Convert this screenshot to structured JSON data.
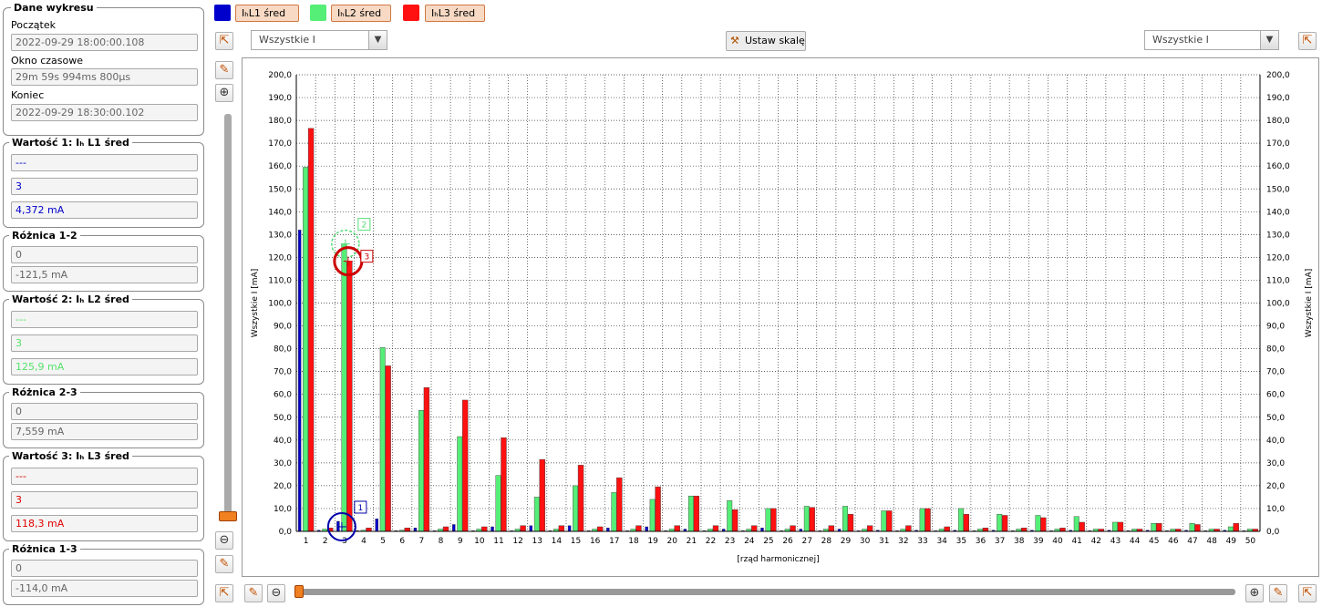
{
  "info": {
    "title": "Dane wykresu",
    "start_label": "Początek",
    "start_value": "2022-09-29 18:00:00.108",
    "window_label": "Okno czasowe",
    "window_value": "29m 59s 994ms 800µs",
    "end_label": "Koniec",
    "end_value": "2022-09-29 18:30:00.102"
  },
  "value1": {
    "title": "Wartość 1: Iₕ L1 śred",
    "f1": "---",
    "f2": "3",
    "f3": "4,372 mA"
  },
  "diff12": {
    "title": "Różnica 1-2",
    "f1": "0",
    "f2": "-121,5 mA"
  },
  "value2": {
    "title": "Wartość 2: Iₕ L2 śred",
    "f1": "---",
    "f2": "3",
    "f3": "125,9 mA"
  },
  "diff23": {
    "title": "Różnica 2-3",
    "f1": "0",
    "f2": "7,559 mA"
  },
  "value3": {
    "title": "Wartość 3: Iₕ L3 śred",
    "f1": "---",
    "f2": "3",
    "f3": "118,3 mA"
  },
  "diff13": {
    "title": "Różnica 1-3",
    "f1": "0",
    "f2": "-114,0 mA"
  },
  "legend": {
    "l1": "IₕL1 śred",
    "l2": "IₕL2 śred",
    "l3": "IₕL3 śred",
    "colors": {
      "l1": "#0000cc",
      "l2": "#55ee77",
      "l3": "#ff1111"
    }
  },
  "toolbar": {
    "combo_left": "Wszystkie I",
    "set_scale": "Ustaw skalę",
    "combo_right": "Wszystkie I"
  },
  "chart_data": {
    "type": "bar",
    "xlabel": "[rząd harmonicznej]",
    "ylabel": "Wszystkie I [mA]",
    "ylabel_right": "Wszystkie I [mA]",
    "ylim": [
      0,
      200
    ],
    "yticks": [
      "0,0",
      "10,0",
      "20,0",
      "30,0",
      "40,0",
      "50,0",
      "60,0",
      "70,0",
      "80,0",
      "90,0",
      "100,0",
      "110,0",
      "120,0",
      "130,0",
      "140,0",
      "150,0",
      "160,0",
      "170,0",
      "180,0",
      "190,0",
      "200,0"
    ],
    "grid": true,
    "categories": [
      "1",
      "2",
      "3",
      "4",
      "5",
      "6",
      "7",
      "8",
      "9",
      "10",
      "11",
      "12",
      "13",
      "14",
      "15",
      "16",
      "17",
      "18",
      "19",
      "20",
      "21",
      "22",
      "23",
      "24",
      "25",
      "26",
      "27",
      "28",
      "29",
      "30",
      "31",
      "32",
      "33",
      "34",
      "35",
      "36",
      "37",
      "38",
      "39",
      "40",
      "41",
      "42",
      "43",
      "44",
      "45",
      "46",
      "47",
      "48",
      "49",
      "50"
    ],
    "series": [
      {
        "name": "IₕL1 śred",
        "color": "#0000cc",
        "values": [
          132,
          0.5,
          4.4,
          0.3,
          5.5,
          0.3,
          1.5,
          0.3,
          3.0,
          0.3,
          2.0,
          0.3,
          2.5,
          0.3,
          2.5,
          0.3,
          1.5,
          0.3,
          2.0,
          0.3,
          1.0,
          0.3,
          1.0,
          0.3,
          1.5,
          0.3,
          1.0,
          0.3,
          1.0,
          0.3,
          0.5,
          0.3,
          0.5,
          0.3,
          0.5,
          0.3,
          0.5,
          0.3,
          0.5,
          0.3,
          0.5,
          0.3,
          0.5,
          0.3,
          0.5,
          0.3,
          0.5,
          0.3,
          0.5,
          0.3
        ]
      },
      {
        "name": "IₕL2 śred",
        "color": "#55ee77",
        "values": [
          159.5,
          1.0,
          125.9,
          0.5,
          80.5,
          0.5,
          53,
          1.0,
          41.5,
          1.0,
          24.5,
          1.0,
          15,
          1.0,
          20,
          1.0,
          17,
          1.0,
          14,
          1.0,
          15.5,
          1.0,
          13.5,
          1.0,
          10,
          1.0,
          11,
          1.0,
          11,
          1.0,
          9,
          1.0,
          10,
          1.0,
          10,
          1.0,
          7.5,
          1.0,
          7,
          1.0,
          6.5,
          1.0,
          4,
          1.0,
          3.5,
          1.0,
          3.5,
          1.0,
          2,
          1.0
        ]
      },
      {
        "name": "IₕL3 śred",
        "color": "#ff1111",
        "values": [
          176.5,
          1.5,
          118.3,
          1.5,
          72.5,
          1.5,
          63,
          2.0,
          57.5,
          2.0,
          41,
          2.5,
          31.5,
          2.5,
          29,
          2.0,
          23.5,
          2.5,
          19.5,
          2.5,
          15.5,
          2.5,
          9.5,
          2.5,
          10,
          2.5,
          10.5,
          2.5,
          7.5,
          2.5,
          9,
          2.5,
          10,
          2.0,
          7.5,
          1.5,
          7,
          1.5,
          6,
          1.5,
          4,
          1.0,
          4,
          1.0,
          3.5,
          1.0,
          3,
          1.0,
          3.5,
          1.0
        ]
      }
    ],
    "markers": [
      {
        "label": "1",
        "category": "3",
        "value": 4.4,
        "color": "#0000aa"
      },
      {
        "label": "2",
        "category": "3",
        "value": 125.9,
        "color": "#55dd77"
      },
      {
        "label": "3",
        "category": "3",
        "value": 118.3,
        "color": "#cc0000"
      }
    ]
  }
}
